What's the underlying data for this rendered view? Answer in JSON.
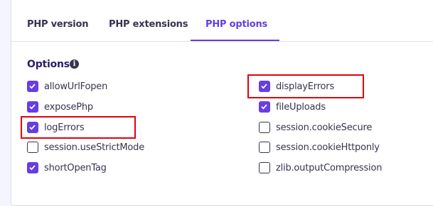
{
  "tabs": [
    {
      "label": "PHP version",
      "active": false
    },
    {
      "label": "PHP extensions",
      "active": false
    },
    {
      "label": "PHP options",
      "active": true
    }
  ],
  "options_section": {
    "heading": "Options",
    "info_icon": "info-icon",
    "info_glyph": "i",
    "left_column": [
      {
        "label": "allowUrlFopen",
        "checked": true
      },
      {
        "label": "exposePhp",
        "checked": true
      },
      {
        "label": "logErrors",
        "checked": true,
        "highlighted": true
      },
      {
        "label": "session.useStrictMode",
        "checked": false
      },
      {
        "label": "shortOpenTag",
        "checked": true
      }
    ],
    "right_column": [
      {
        "label": "displayErrors",
        "checked": true,
        "highlighted": true
      },
      {
        "label": "fileUploads",
        "checked": true
      },
      {
        "label": "session.cookieSecure",
        "checked": false
      },
      {
        "label": "session.cookieHttponly",
        "checked": false
      },
      {
        "label": "zlib.outputCompression",
        "checked": false
      }
    ]
  },
  "colors": {
    "accent": "#673de6",
    "text": "#36344d",
    "heading": "#2f1c6a",
    "highlight": "#e0000f",
    "page_background": "#f4f5ff"
  }
}
